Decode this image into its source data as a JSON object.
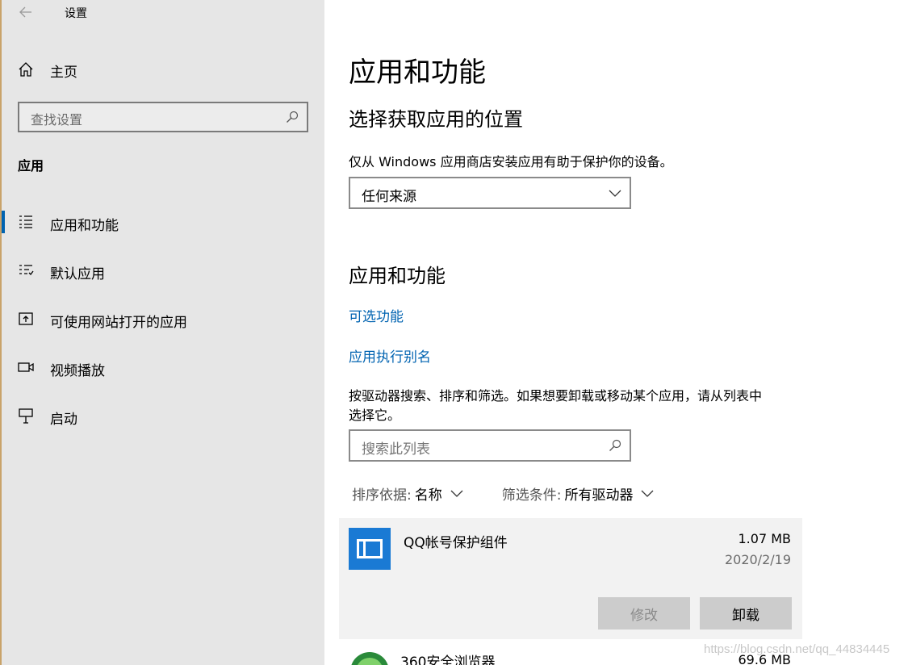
{
  "window": {
    "title": "设置"
  },
  "sidebar": {
    "home_label": "主页",
    "search_placeholder": "查找设置",
    "section_heading": "应用",
    "items": [
      {
        "label": "应用和功能",
        "icon": "apps-list-icon",
        "selected": true
      },
      {
        "label": "默认应用",
        "icon": "default-apps-icon",
        "selected": false
      },
      {
        "label": "可使用网站打开的应用",
        "icon": "open-website-icon",
        "selected": false
      },
      {
        "label": "视频播放",
        "icon": "video-playback-icon",
        "selected": false
      },
      {
        "label": "启动",
        "icon": "startup-icon",
        "selected": false
      }
    ]
  },
  "main": {
    "page_title": "应用和功能",
    "source_section": {
      "heading": "选择获取应用的位置",
      "description": "仅从 Windows 应用商店安装应用有助于保护你的设备。",
      "dropdown_value": "任何来源"
    },
    "apps_section": {
      "heading": "应用和功能",
      "link_optional_features": "可选功能",
      "link_app_aliases": "应用执行别名",
      "description_line1": "按驱动器搜索、排序和筛选。如果想要卸载或移动某个应用，请从列表中",
      "description_line2": "选择它。",
      "search_placeholder": "搜索此列表",
      "sort_label": "排序依据:",
      "sort_value": "名称",
      "filter_label": "筛选条件:",
      "filter_value": "所有驱动器"
    },
    "apps": [
      {
        "name": "QQ帐号保护组件",
        "size": "1.07 MB",
        "date": "2020/2/19",
        "modify_label": "修改",
        "uninstall_label": "卸载"
      },
      {
        "name": "360安全浏览器",
        "size": "69.6 MB"
      }
    ]
  },
  "watermark": "https://blog.csdn.net/qq_44834445",
  "colors": {
    "accent": "#0063b1",
    "sidebar_bg": "#e6e6e6",
    "card_bg": "#f2f2f2"
  }
}
